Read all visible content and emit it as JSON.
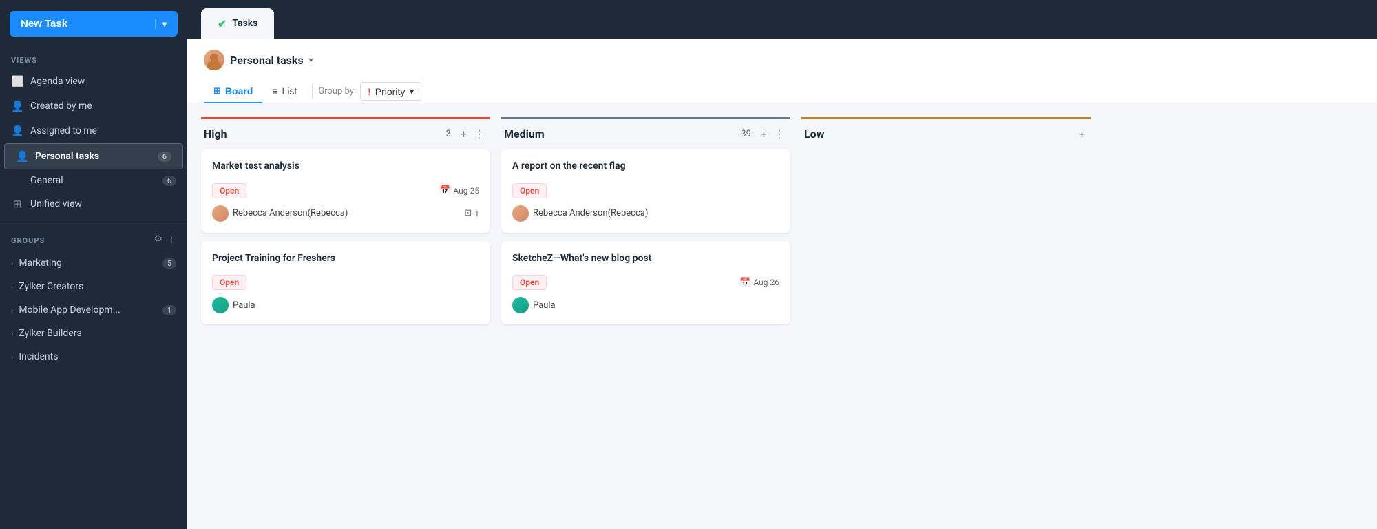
{
  "sidebar": {
    "new_task_label": "New Task",
    "views_label": "VIEWS",
    "views": [
      {
        "id": "agenda",
        "label": "Agenda view",
        "icon": "📅"
      },
      {
        "id": "created",
        "label": "Created by me",
        "icon": "👤"
      },
      {
        "id": "assigned",
        "label": "Assigned to me",
        "icon": "👤"
      },
      {
        "id": "personal",
        "label": "Personal tasks",
        "icon": "👤",
        "badge": "6",
        "active": true
      },
      {
        "id": "general",
        "label": "General",
        "badge": "6",
        "sub": true
      },
      {
        "id": "unified",
        "label": "Unified view",
        "icon": "🔄"
      }
    ],
    "groups_label": "GROUPS",
    "groups": [
      {
        "id": "marketing",
        "label": "Marketing",
        "badge": "5"
      },
      {
        "id": "zylker-creators",
        "label": "Zylker Creators",
        "badge": ""
      },
      {
        "id": "mobile-app",
        "label": "Mobile App Developm...",
        "badge": "1"
      },
      {
        "id": "zylker-builders",
        "label": "Zylker Builders",
        "badge": ""
      },
      {
        "id": "incidents",
        "label": "Incidents",
        "badge": ""
      }
    ]
  },
  "header": {
    "tab_label": "Tasks"
  },
  "content": {
    "personal_tasks_title": "Personal tasks",
    "board_tab": "Board",
    "list_tab": "List",
    "group_by_label": "Group by:",
    "priority_label": "Priority"
  },
  "columns": [
    {
      "id": "high",
      "title": "High",
      "count": "3",
      "color_class": "high",
      "cards": [
        {
          "id": "card1",
          "title": "Market test analysis",
          "status": "Open",
          "date": "Aug 25",
          "assignee_name": "Rebecca Anderson(Rebecca)",
          "assignee_type": "warm",
          "subtask_count": "1"
        },
        {
          "id": "card2",
          "title": "Project Training for Freshers",
          "status": "Open",
          "date": "",
          "assignee_name": "Paula",
          "assignee_type": "teal",
          "subtask_count": ""
        }
      ]
    },
    {
      "id": "medium",
      "title": "Medium",
      "count": "39",
      "color_class": "medium",
      "cards": [
        {
          "id": "card3",
          "title": "A report on the recent flag",
          "status": "Open",
          "date": "",
          "assignee_name": "Rebecca Anderson(Rebecca)",
          "assignee_type": "warm",
          "subtask_count": ""
        },
        {
          "id": "card4",
          "title": "SketcheZ—What's new blog post",
          "status": "Open",
          "date": "Aug 26",
          "assignee_name": "Paula",
          "assignee_type": "teal",
          "subtask_count": ""
        }
      ]
    },
    {
      "id": "low",
      "title": "Low",
      "count": "",
      "color_class": "low",
      "cards": []
    }
  ]
}
